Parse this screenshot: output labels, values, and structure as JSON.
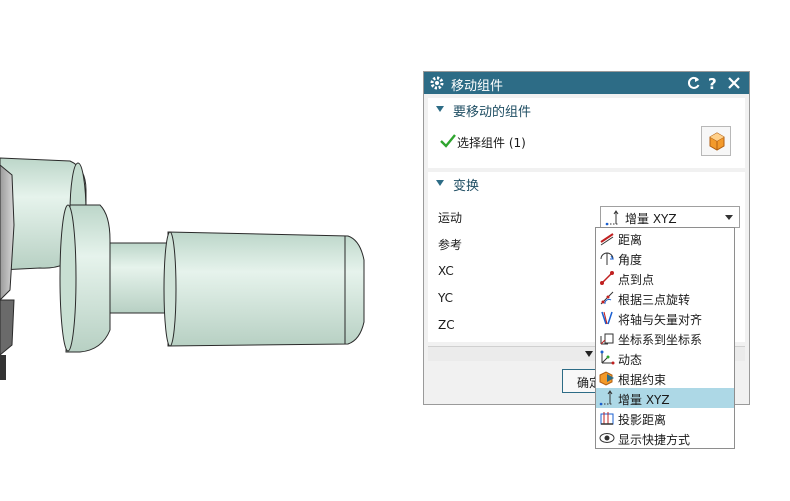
{
  "dialog": {
    "title": "移动组件",
    "section_components": {
      "title": "要移动的组件",
      "select_label": "选择组件 (1)"
    },
    "section_transform": {
      "title": "变换",
      "motion_label": "运动",
      "motion_value": "增量 XYZ",
      "reference_label": "参考",
      "xc_label": "XC",
      "yc_label": "YC",
      "zc_label": "ZC"
    },
    "ok_label": "确定"
  },
  "dropdown": {
    "items": [
      {
        "label": "距离",
        "icon": "distance-icon"
      },
      {
        "label": "角度",
        "icon": "angle-icon"
      },
      {
        "label": "点到点",
        "icon": "point-to-point-icon"
      },
      {
        "label": "根据三点旋转",
        "icon": "three-point-rotate-icon"
      },
      {
        "label": "将轴与矢量对齐",
        "icon": "align-axis-vector-icon"
      },
      {
        "label": "坐标系到坐标系",
        "icon": "csys-to-csys-icon"
      },
      {
        "label": "动态",
        "icon": "dynamic-icon"
      },
      {
        "label": "根据约束",
        "icon": "by-constraints-icon"
      },
      {
        "label": "增量 XYZ",
        "icon": "delta-xyz-icon",
        "selected": true
      },
      {
        "label": "投影距离",
        "icon": "projection-distance-icon"
      },
      {
        "label": "显示快捷方式",
        "icon": "show-shortcuts-icon"
      }
    ]
  },
  "colors": {
    "title_bar": "#2d6c86",
    "selected_item": "#add8e6",
    "part_fill": "#d9ebe2"
  }
}
